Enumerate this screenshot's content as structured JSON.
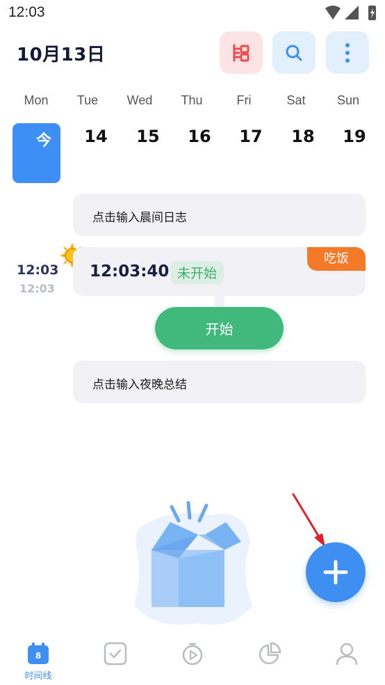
{
  "status_bar": {
    "time": "12:03"
  },
  "header": {
    "date": "10月13日"
  },
  "week": {
    "days": [
      {
        "weekday": "Mon",
        "date": "今",
        "today": true
      },
      {
        "weekday": "Tue",
        "date": "14"
      },
      {
        "weekday": "Wed",
        "date": "15"
      },
      {
        "weekday": "Thu",
        "date": "16"
      },
      {
        "weekday": "Fri",
        "date": "17"
      },
      {
        "weekday": "Sat",
        "date": "18"
      },
      {
        "weekday": "Sun",
        "date": "19"
      }
    ]
  },
  "timeline": {
    "morning_prompt": "点击输入晨间日志",
    "task": {
      "time": "12:03",
      "time_sub": "12:03",
      "clock": "12:03:40",
      "status": "未开始",
      "tag": "吃饭",
      "tag_color": "#f47a27"
    },
    "start_label": "开始",
    "evening_prompt": "点击输入夜晚总结"
  },
  "nav": {
    "items": [
      {
        "label": "时间线",
        "icon": "calendar-icon",
        "active": true,
        "badge": "8"
      },
      {
        "icon": "checkbox-icon"
      },
      {
        "icon": "timer-icon"
      },
      {
        "icon": "pie-chart-icon"
      },
      {
        "icon": "person-icon"
      }
    ]
  },
  "colors": {
    "accent": "#3f8ff2",
    "start": "#42b97c",
    "tag": "#f47a27",
    "record": "#f0484b"
  }
}
